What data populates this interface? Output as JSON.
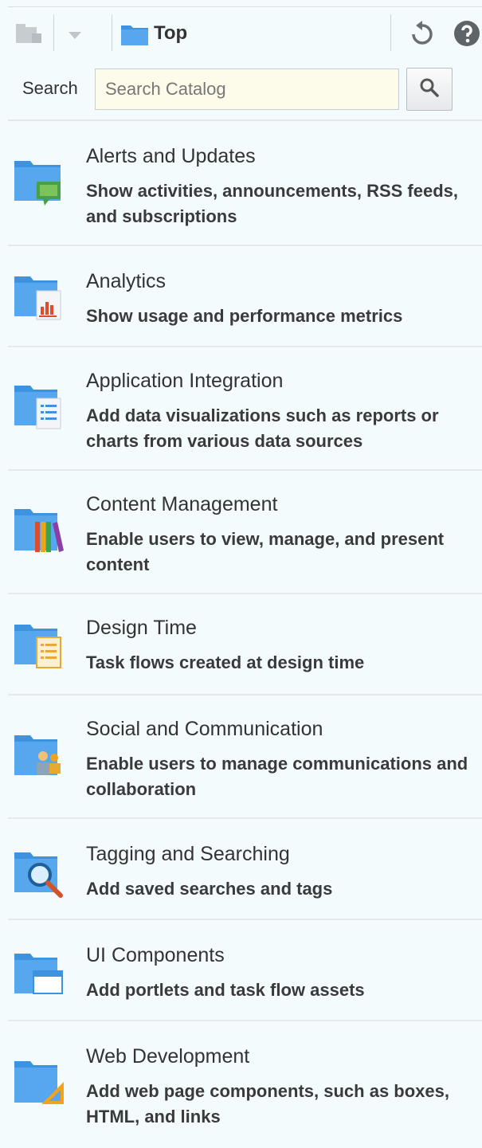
{
  "toolbar": {
    "breadcrumb": "Top",
    "icons": [
      "catalog-icon",
      "dropdown-icon",
      "folder-icon",
      "refresh-icon",
      "help-icon"
    ]
  },
  "search": {
    "label": "Search",
    "placeholder": "Search Catalog",
    "value": ""
  },
  "catalog": {
    "items": [
      {
        "title": "Alerts and Updates",
        "desc": "Show activities, announcements, RSS feeds, and subscriptions",
        "icon": "alerts-folder-icon"
      },
      {
        "title": "Analytics",
        "desc": "Show usage and performance metrics",
        "icon": "analytics-folder-icon"
      },
      {
        "title": "Application Integration",
        "desc": "Add data visualizations such as reports or charts from various data sources",
        "icon": "integration-folder-icon"
      },
      {
        "title": "Content Management",
        "desc": "Enable users to view, manage, and present content",
        "icon": "content-folder-icon"
      },
      {
        "title": "Design Time",
        "desc": "Task flows created at design time",
        "icon": "design-folder-icon"
      },
      {
        "title": "Social and Communication",
        "desc": "Enable users to manage communications and collaboration",
        "icon": "social-folder-icon"
      },
      {
        "title": "Tagging and Searching",
        "desc": "Add saved searches and tags",
        "icon": "tagging-folder-icon"
      },
      {
        "title": "UI Components",
        "desc": "Add portlets and task flow assets",
        "icon": "ui-components-folder-icon"
      },
      {
        "title": "Web Development",
        "desc": "Add web page components, such as boxes, HTML, and links",
        "icon": "web-dev-folder-icon"
      }
    ]
  },
  "colors": {
    "background": "#f4fbfd",
    "folder_blue": "#4f9fe6",
    "input_bg": "#fdfbe9"
  }
}
